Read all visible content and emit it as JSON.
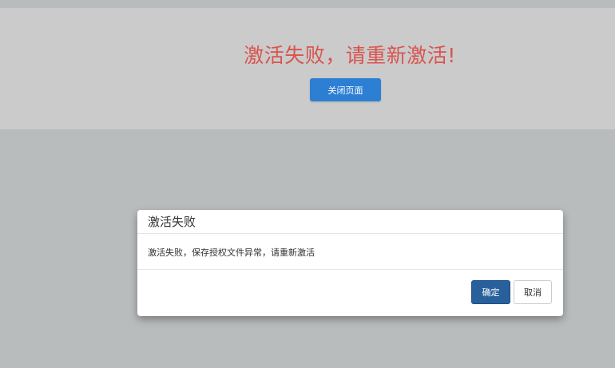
{
  "banner": {
    "title": "激活失败，请重新激活!",
    "close_button_label": "关闭页面"
  },
  "dialog": {
    "title": "激活失败",
    "message": "激活失败，保存授权文件异常，请重新激活",
    "confirm_label": "确定",
    "cancel_label": "取消"
  },
  "colors": {
    "error_text": "#d9534f",
    "primary_button": "#2d7fd3",
    "confirm_button": "#28609b",
    "overlay": "#b9bcbd"
  }
}
